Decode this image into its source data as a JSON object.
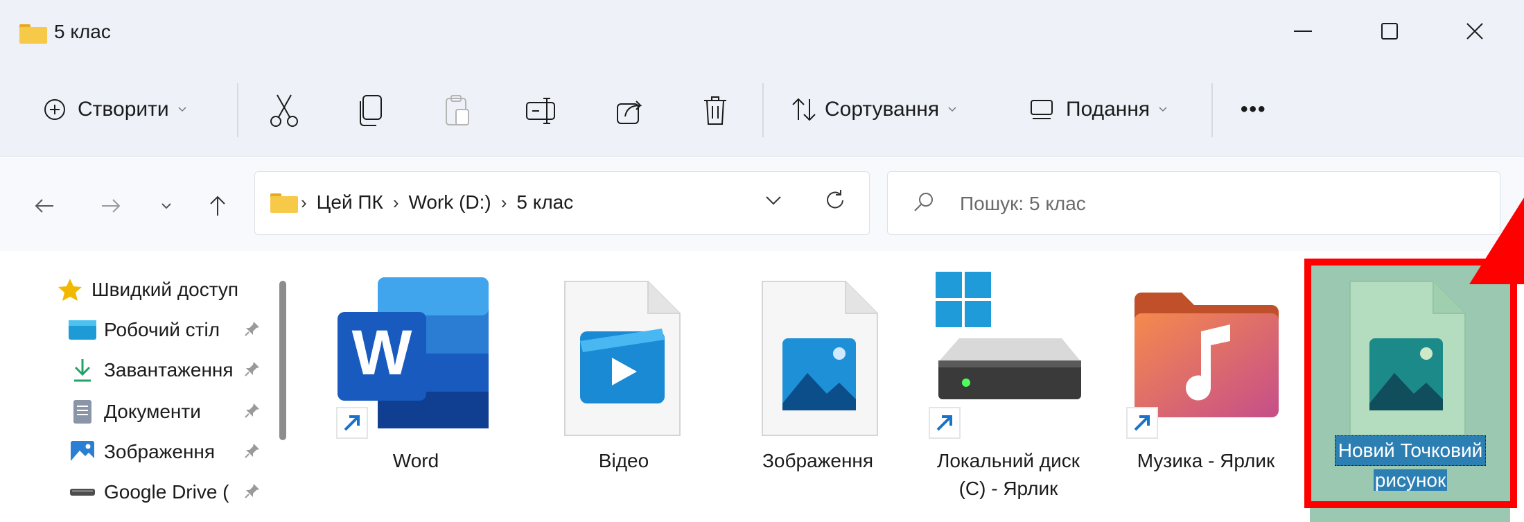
{
  "window": {
    "title": "5 клас"
  },
  "toolbar": {
    "create_label": "Створити",
    "sort_label": "Сортування",
    "view_label": "Подання",
    "more_label": "•••"
  },
  "address": {
    "crumbs": [
      "Цей ПК",
      "Work (D:)",
      "5 клас"
    ],
    "search_placeholder": "Пошук: 5 клас"
  },
  "sidebar": {
    "items": [
      {
        "label": "Швидкий доступ",
        "icon": "star-icon"
      },
      {
        "label": "Робочий стіл",
        "icon": "desktop-icon"
      },
      {
        "label": "Завантаження",
        "icon": "download-icon"
      },
      {
        "label": "Документи",
        "icon": "documents-icon"
      },
      {
        "label": "Зображення",
        "icon": "pictures-icon"
      },
      {
        "label": "Google Drive (",
        "icon": "drive-icon"
      }
    ]
  },
  "files": [
    {
      "name": "Word",
      "icon": "word-icon",
      "shortcut": true
    },
    {
      "name": "Відео",
      "icon": "video-file-icon",
      "shortcut": false
    },
    {
      "name": "Зображення",
      "icon": "image-file-icon",
      "shortcut": false
    },
    {
      "name_line1": "Локальний диск",
      "name_line2": "(C) - Ярлик",
      "icon": "local-disk-icon",
      "shortcut": true
    },
    {
      "name": "Музика - Ярлик",
      "icon": "music-folder-icon",
      "shortcut": true
    },
    {
      "name_line1": "Новий Точковий",
      "name_line2": "рисунок",
      "icon": "bitmap-file-icon",
      "shortcut": false,
      "selected": true
    }
  ],
  "colors": {
    "accent": "#ff0000",
    "selection": "#9ac8b0",
    "text_highlight": "#2c7fb3"
  }
}
